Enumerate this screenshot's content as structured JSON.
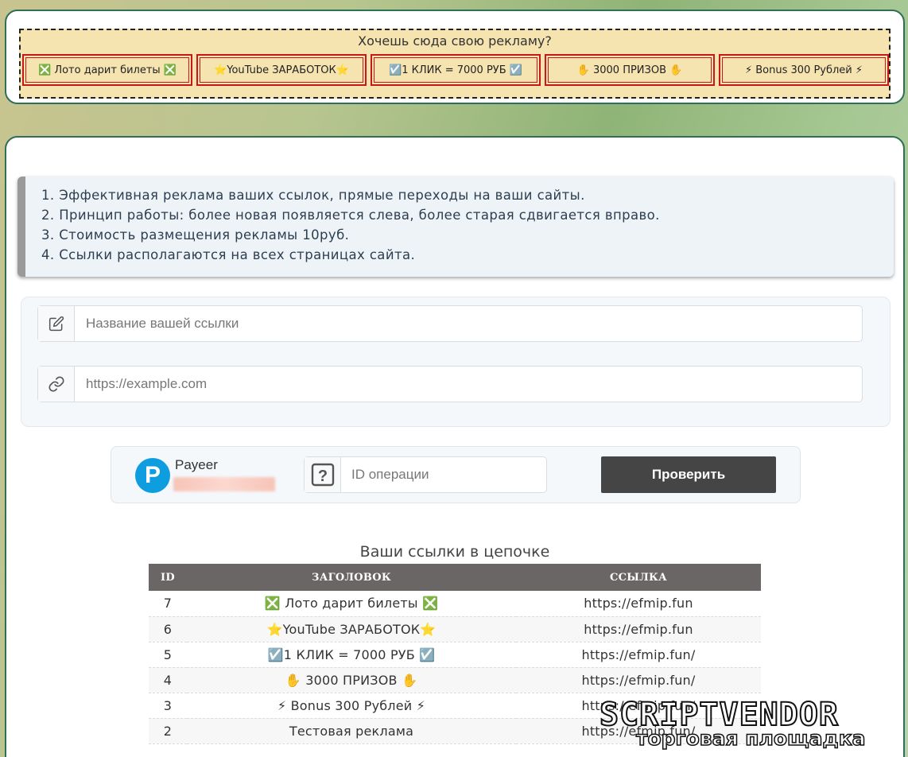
{
  "ad_panel": {
    "title": "Хочешь сюда свою рекламу?",
    "slots": [
      {
        "label": "❎ Лото дарит билеты ❎"
      },
      {
        "label": "⭐YouTube ЗАРАБОТОК⭐"
      },
      {
        "label": "☑️1 КЛИК = 7000 РУБ ☑️"
      },
      {
        "label": "✋ 3000 ПРИЗОВ ✋"
      },
      {
        "label": "⚡ Bonus 300 Рублей ⚡"
      }
    ]
  },
  "info": {
    "items": [
      "1. Эффективная реклама ваших ссылок, прямые переходы на ваши сайты.",
      "2. Принцип работы: более новая появляется слева, более старая сдвигается вправо.",
      "3. Стоимость размещения рекламы 10руб.",
      "4. Ссылки располагаются на всех страницах сайта."
    ]
  },
  "form": {
    "title_placeholder": "Название вашей ссылки",
    "url_placeholder": "https://example.com",
    "title_icon": "edit-icon",
    "url_icon": "link-icon"
  },
  "payment": {
    "provider": "Payeer",
    "logo_letter": "P",
    "operation_placeholder": "ID операции",
    "operation_icon": "question-icon",
    "check_label": "Проверить",
    "brand_color": "#0e9ee0"
  },
  "links_table": {
    "title": "Ваши ссылки в цепочке",
    "columns": [
      "ID",
      "ЗАГОЛОВОК",
      "ССЫЛКА"
    ],
    "rows": [
      {
        "id": "7",
        "title": "❎ Лото дарит билеты ❎",
        "link": "https://efmip.fun"
      },
      {
        "id": "6",
        "title": "⭐YouTube ЗАРАБОТОК⭐",
        "link": "https://efmip.fun"
      },
      {
        "id": "5",
        "title": "☑️1 КЛИК = 7000 РУБ ☑️",
        "link": "https://efmip.fun/"
      },
      {
        "id": "4",
        "title": "✋ 3000 ПРИЗОВ ✋",
        "link": "https://efmip.fun/"
      },
      {
        "id": "3",
        "title": "⚡ Bonus 300 Рублей ⚡",
        "link": "https://efmip.fun/"
      },
      {
        "id": "2",
        "title": "Тестовая реклама",
        "link": "https://efmip.fun/"
      }
    ]
  },
  "watermark": {
    "brand": "SCRIPTVENDOR",
    "tagline": "торговая площадка"
  }
}
